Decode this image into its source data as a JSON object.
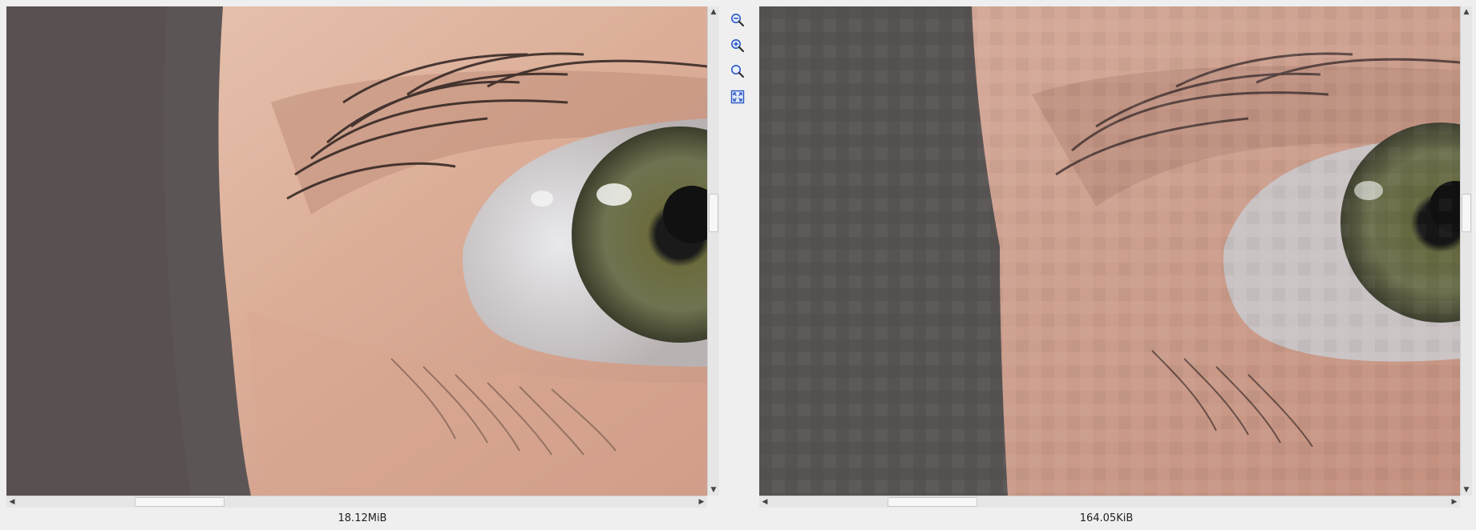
{
  "toolbar": {
    "zoom_out_icon": "zoom-out-icon",
    "zoom_in_icon": "zoom-in-icon",
    "zoom_original_icon": "zoom-original-icon",
    "fit_to_window_icon": "fit-to-window-icon"
  },
  "left_panel": {
    "image_description_icon": "original-image",
    "file_size": "18.12MiB"
  },
  "right_panel": {
    "image_description_icon": "compressed-image",
    "file_size": "164.05KiB"
  },
  "colors": {
    "background": "#efefef",
    "icon_accent": "#2a56c6",
    "scroll_track": "#e6e6e6"
  }
}
